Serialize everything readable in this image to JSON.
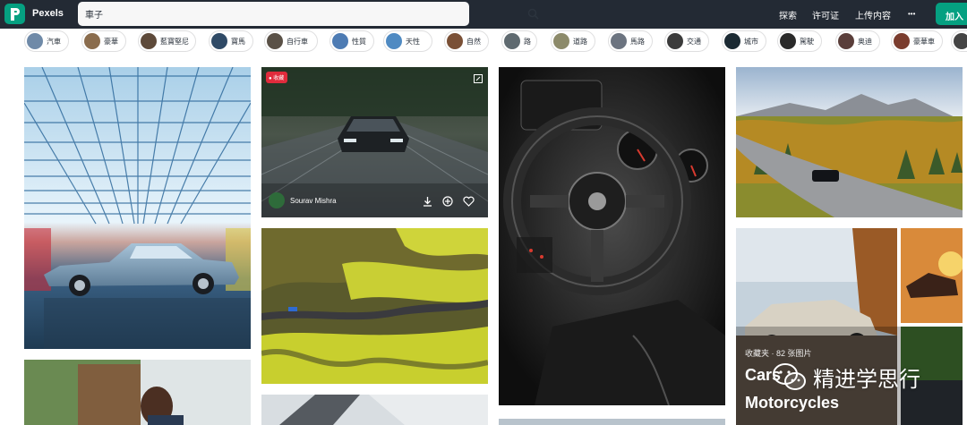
{
  "header": {
    "logo_text": "Pexels",
    "search_value": "車子",
    "nav": [
      "探索",
      "许可证",
      "上传内容"
    ],
    "more": "•••",
    "join": "加入"
  },
  "chips": [
    {
      "label": "汽車",
      "color": "#6f8aa8"
    },
    {
      "label": "豪華",
      "color": "#8a6c4d"
    },
    {
      "label": "藍寶堅尼",
      "color": "#5e4a3a"
    },
    {
      "label": "寶馬",
      "color": "#2f4a66"
    },
    {
      "label": "自行車",
      "color": "#5a5147"
    },
    {
      "label": "性質",
      "color": "#4d7bb3"
    },
    {
      "label": "天性",
      "color": "#4f8ac2"
    },
    {
      "label": "自然",
      "color": "#7a5036"
    },
    {
      "label": "路",
      "color": "#5f6a70"
    },
    {
      "label": "道路",
      "color": "#8c8a6a"
    },
    {
      "label": "馬路",
      "color": "#6c7480"
    },
    {
      "label": "交通",
      "color": "#3b3b3b"
    },
    {
      "label": "城市",
      "color": "#1b2a33"
    },
    {
      "label": "駕駛",
      "color": "#2a2a2a"
    },
    {
      "label": "奥迪",
      "color": "#5a3e3a"
    },
    {
      "label": "豪華車",
      "color": "#7a3c2e"
    },
    {
      "label": "",
      "color": "#444"
    }
  ],
  "photo2": {
    "badge": "收藏",
    "photographer": "Sourav Mishra"
  },
  "collection": {
    "meta": "收藏夹 · 82 张图片",
    "title_line1": "Cars",
    "title_line2": "Motorcycles"
  },
  "watermark": "精进学思行"
}
